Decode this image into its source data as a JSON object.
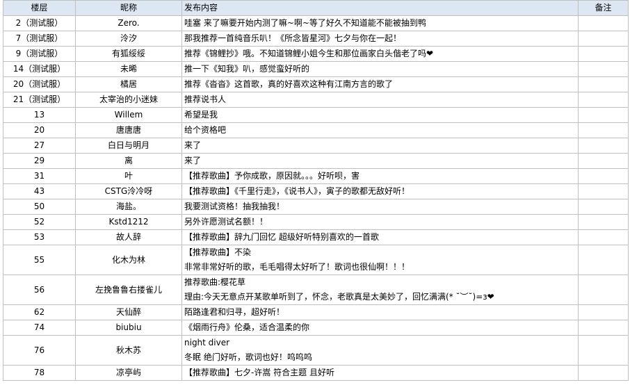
{
  "headers": [
    "楼层",
    "昵称",
    "发布内容",
    "备注"
  ],
  "rows": [
    {
      "floor": "2（测试服）",
      "name": "Zero.",
      "content": [
        "哇塞 来了嘛要开始内测了嘛~啊~等了好久不知道能不能被抽到鸭"
      ],
      "note": ""
    },
    {
      "floor": "7（测试服）",
      "name": "泠汐",
      "content": [
        "那我推荐一首纯音乐叭！《所念皆星河》七夕与你在一起！"
      ],
      "note": ""
    },
    {
      "floor": "9（测试服）",
      "name": "有狐绥绥",
      "content": [
        "推荐《锦鲤抄》哦。不知道锦鲤小姐今生和那位画家白头偕老了吗❤"
      ],
      "note": ""
    },
    {
      "floor": "14（测试服）",
      "name": "未晞",
      "content": [
        "推一下《知我》叭，感觉蛮好听的"
      ],
      "note": ""
    },
    {
      "floor": "20（测试服）",
      "name": "橘居",
      "content": [
        "推荐《沓沓》这首歌，真的好喜欢这种有江南方言的歌了"
      ],
      "note": ""
    },
    {
      "floor": "21（测试服）",
      "name": "太宰治的小迷妹",
      "content": [
        "推荐说书人"
      ],
      "note": ""
    },
    {
      "floor": "13",
      "name": "Willem",
      "content": [
        "希望是我"
      ],
      "note": ""
    },
    {
      "floor": "20",
      "name": "唐唐唐",
      "content": [
        "给个资格吧"
      ],
      "note": ""
    },
    {
      "floor": "27",
      "name": "白日与明月",
      "content": [
        "来了"
      ],
      "note": ""
    },
    {
      "floor": "29",
      "name": "离",
      "content": [
        "来了"
      ],
      "note": ""
    },
    {
      "floor": "31",
      "name": "叶",
      "content": [
        "【推荐歌曲】予你成歌，原因就。。。好听呗，害"
      ],
      "note": ""
    },
    {
      "floor": "43",
      "name": "CSTG泠冷呀",
      "content": [
        "【推荐歌曲】《千里行走》，《说书人》，寅子的歌都无敌好听！"
      ],
      "note": ""
    },
    {
      "floor": "50",
      "name": "海盐。",
      "content": [
        "我要测试资格！抽我抽我！"
      ],
      "note": ""
    },
    {
      "floor": "52",
      "name": "Kstd1212",
      "content": [
        "另外许愿测试名额！！"
      ],
      "note": ""
    },
    {
      "floor": "53",
      "name": "故人辞",
      "content": [
        "【推荐歌曲】辞九门回忆 超级好听特别喜欢的一首歌"
      ],
      "note": ""
    },
    {
      "floor": "55",
      "name": "化木为林",
      "content": [
        "【推荐歌曲】不染",
        "非常非常好听的歌，毛毛唱得太好听了！歌词也很仙啊！！！"
      ],
      "note": ""
    },
    {
      "floor": "56",
      "name": "左挽鲁鲁右搂雀儿",
      "content": [
        "推荐歌曲:樱花草",
        "理由:今天无意点开某歌单听到了，怀念，老歌真是太美妙了，回忆满满(* ˘︶˘)=з❤"
      ],
      "note": ""
    },
    {
      "floor": "62",
      "name": "天仙醉",
      "content": [
        "陌路逢君和归寻，超好听！"
      ],
      "note": ""
    },
    {
      "floor": "74",
      "name": "biubiu",
      "content": [
        "《烟雨行舟》伦桑，适合温柔的你"
      ],
      "note": ""
    },
    {
      "floor": "76",
      "name": "秋木苏",
      "content": [
        "night diver",
        "冬眠 绝门好听，歌词也好！呜呜呜"
      ],
      "note": ""
    },
    {
      "floor": "78",
      "name": "凉亭屿",
      "content": [
        "【推荐歌曲】七夕-许嵩 符合主题 且好听"
      ],
      "note": ""
    }
  ]
}
